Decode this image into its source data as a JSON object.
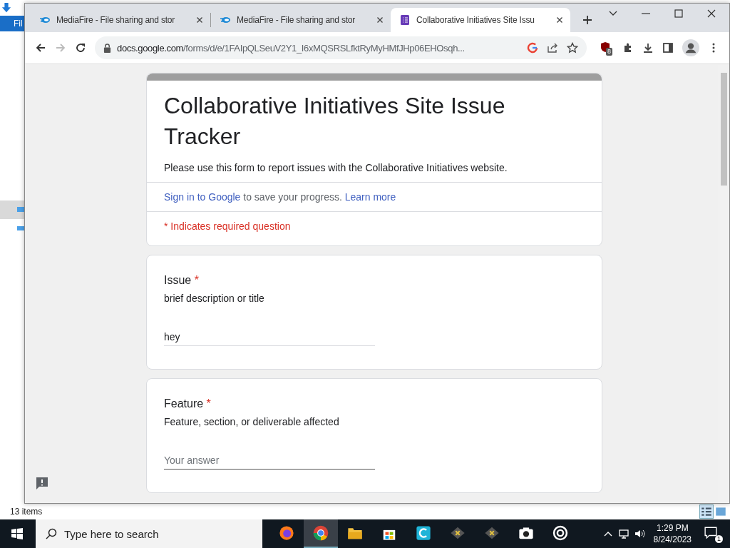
{
  "background_window": {
    "menu_tab": "Fil",
    "status_text": "13 items"
  },
  "browser": {
    "tabs": [
      {
        "title": "MediaFire - File sharing and stor",
        "kind": "mediafire",
        "selected": false
      },
      {
        "title": "MediaFire - File sharing and stor",
        "kind": "mediafire",
        "selected": false
      },
      {
        "title": "Collaborative Initiatives Site Issu",
        "kind": "forms",
        "selected": true
      }
    ],
    "address_host": "docs.google.com",
    "address_path": "/forms/d/e/1FAIpQLSeuV2Y1_I6xMQSRSLfktRyMyHMfJHp06EHOsqh...",
    "extension_badge": "8"
  },
  "form": {
    "title": "Collaborative Initiatives Site Issue Tracker",
    "description": "Please use this form to report issues with the Collaborative Initiatives website.",
    "sign_in_link": "Sign in to Google",
    "sign_in_text": " to save your progress. ",
    "learn_more": "Learn more",
    "required_note": "* Indicates required question",
    "questions": [
      {
        "title": "Issue",
        "required_mark": "*",
        "description": "brief description or title",
        "value": "hey"
      },
      {
        "title": "Feature",
        "required_mark": "*",
        "description": "Feature, section, or deliverable affected",
        "placeholder": "Your answer"
      }
    ]
  },
  "taskbar": {
    "search_placeholder": "Type here to search",
    "apps": [
      {
        "kind": "firefox",
        "selected": false
      },
      {
        "kind": "chrome",
        "selected": true
      },
      {
        "kind": "folder",
        "selected": false
      },
      {
        "kind": "store",
        "selected": false
      },
      {
        "kind": "c",
        "selected": false
      },
      {
        "kind": "x",
        "selected": false
      },
      {
        "kind": "x",
        "selected": false
      },
      {
        "kind": "camera",
        "selected": false
      },
      {
        "kind": "ring",
        "selected": false
      }
    ],
    "time": "1:29 PM",
    "date": "8/24/2023",
    "notification_count": "1"
  }
}
